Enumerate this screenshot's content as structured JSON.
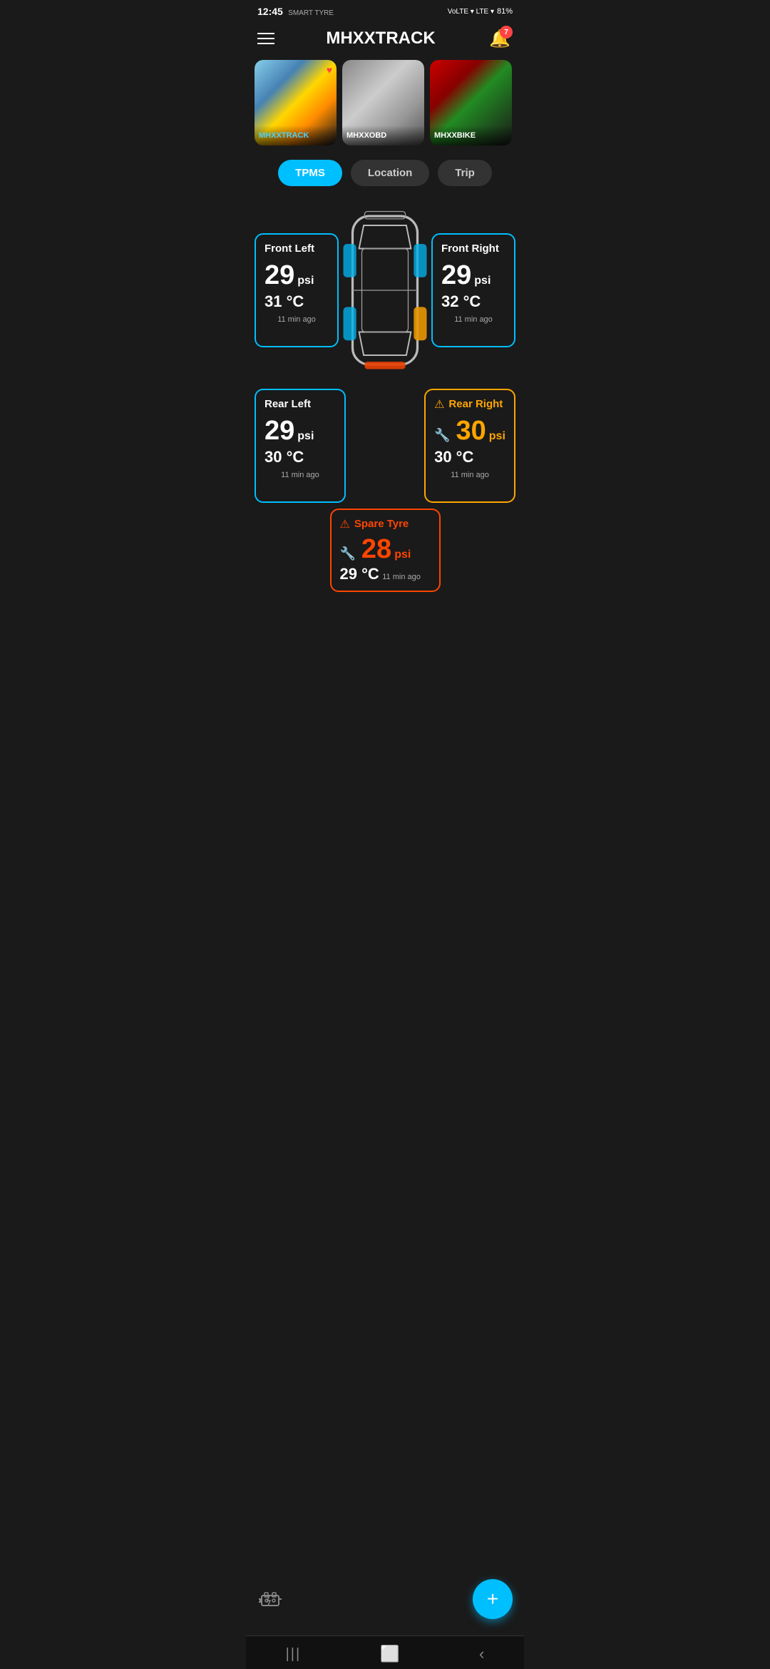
{
  "statusBar": {
    "time": "12:45",
    "brand": "SMART TYRE",
    "network1": "VoLTE LTE1",
    "network2": "VoLTE LTE2",
    "battery": "81%"
  },
  "header": {
    "title": "MHXXTRACK",
    "menuIcon": "☰",
    "notifIcon": "🔔",
    "notifCount": "7"
  },
  "vehicles": [
    {
      "name": "MHXXTRACK",
      "nameColor": "cyan",
      "hasFavorite": true
    },
    {
      "name": "MHXXOBD",
      "nameColor": "white",
      "hasFavorite": false
    },
    {
      "name": "MHXXBIKE",
      "nameColor": "white",
      "hasFavorite": false
    }
  ],
  "tabs": [
    {
      "label": "TPMS",
      "active": true
    },
    {
      "label": "Location",
      "active": false
    },
    {
      "label": "Trip",
      "active": false
    }
  ],
  "tpms": {
    "frontLeft": {
      "name": "Front Left",
      "pressure": "29",
      "pressureUnit": "psi",
      "temp": "31 °C",
      "time": "11 min ago",
      "status": "normal"
    },
    "frontRight": {
      "name": "Front Right",
      "pressure": "29",
      "pressureUnit": "psi",
      "temp": "32 °C",
      "time": "11 min ago",
      "status": "normal"
    },
    "rearLeft": {
      "name": "Rear Left",
      "pressure": "29",
      "pressureUnit": "psi",
      "temp": "30 °C",
      "time": "11 min ago",
      "status": "normal"
    },
    "rearRight": {
      "name": "Rear Right",
      "pressure": "30",
      "pressureUnit": "psi",
      "temp": "30 °C",
      "time": "11 min ago",
      "status": "warning"
    },
    "spare": {
      "name": "Spare Tyre",
      "pressure": "28",
      "pressureUnit": "psi",
      "temp": "29 °C",
      "time": "11 min ago",
      "status": "danger"
    }
  },
  "fab": {
    "icon": "+"
  },
  "bottomNav": {
    "back": "‹",
    "home": "○",
    "recent": "|||"
  }
}
